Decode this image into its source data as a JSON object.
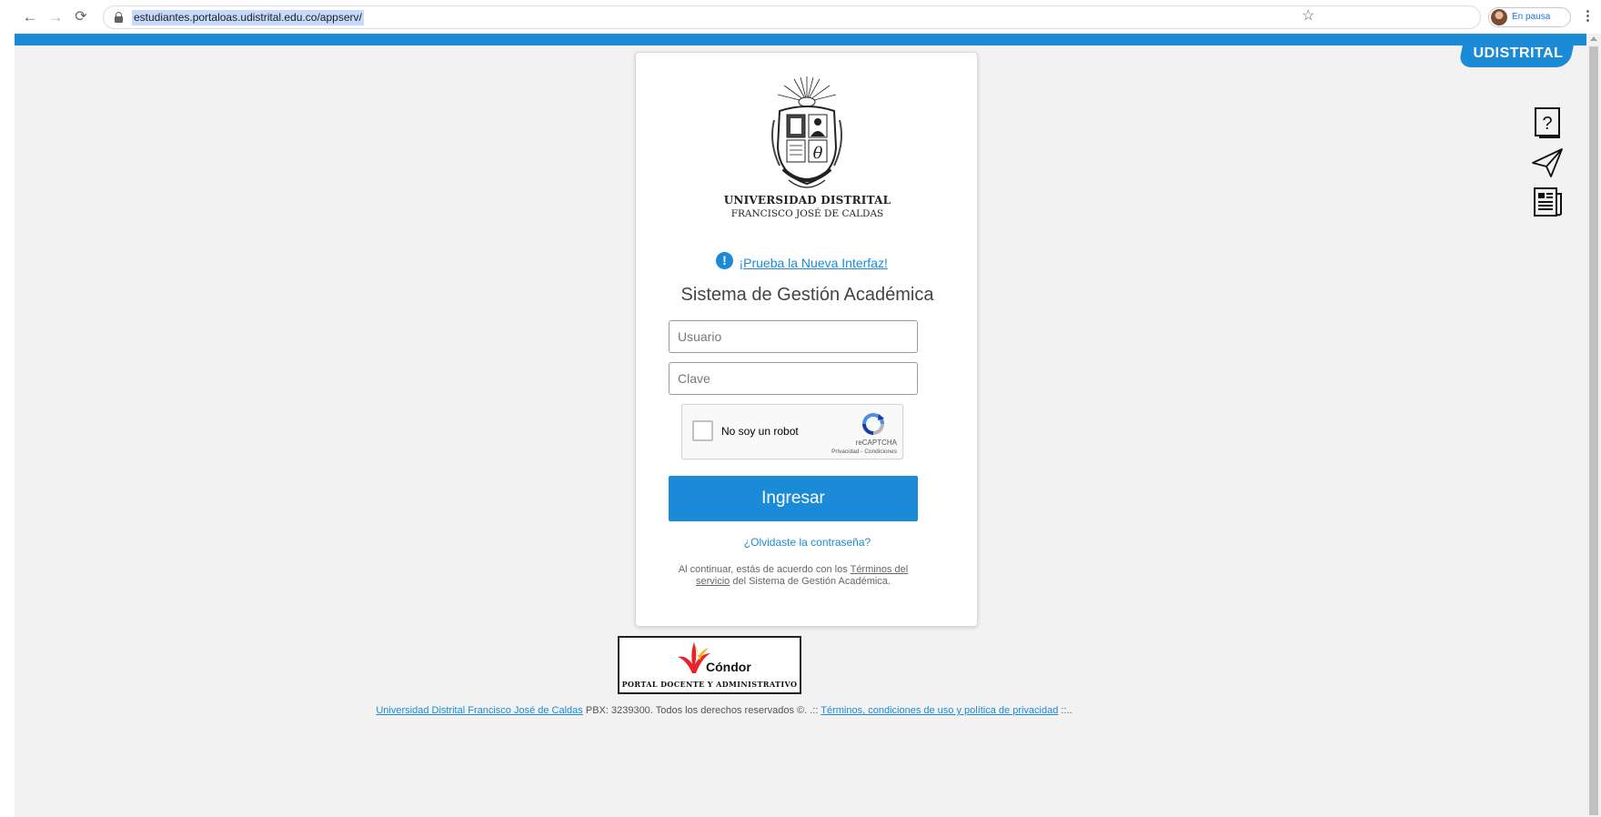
{
  "browser": {
    "url": "estudiantes.portaloas.udistrital.edu.co/appserv/",
    "profile_status": "En pausa",
    "icons": [
      "back-arrow-icon",
      "forward-arrow-icon",
      "reload-icon",
      "lock-icon",
      "star-icon",
      "avatar",
      "more-vert-icon"
    ]
  },
  "brand": {
    "tab_label": "UDISTRITAL",
    "accent_color": "#1b8ad7"
  },
  "side_icons": [
    "help-icon",
    "send-icon",
    "news-icon"
  ],
  "login": {
    "university_name": "UNIVERSIDAD DISTRITAL",
    "university_subtitle": "FRANCISCO JOSÉ DE CALDAS",
    "notice_link": "¡Prueba la Nueva Interfaz!",
    "system_title": "Sistema de Gestión Académica",
    "username_placeholder": "Usuario",
    "password_placeholder": "Clave",
    "captcha": {
      "label": "No soy un robot",
      "brand": "reCAPTCHA",
      "links": "Privacidad - Condiciones"
    },
    "submit_label": "Ingresar",
    "forgot_password": "¿Olvidaste la contraseña?",
    "terms_prefix": "Al continuar, estás de acuerdo con los ",
    "terms_link": "Términos del servicio",
    "terms_suffix": " del Sistema de Gestión Académica."
  },
  "condor": {
    "name": "Cóndor",
    "subtitle": "PORTAL DOCENTE Y ADMINISTRATIVO"
  },
  "footer": {
    "university_link": "Universidad Distrital Francisco José de Caldas",
    "middle_text": " PBX: 3239300. Todos los derechos reservados ©. .:: ",
    "terms_link": "Términos, condiciones de uso y política de privacidad",
    "suffix": " ::.."
  }
}
